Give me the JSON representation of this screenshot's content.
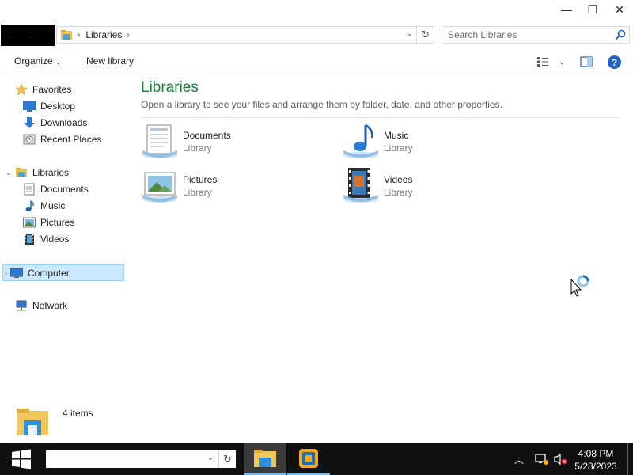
{
  "window": {
    "minimize_glyph": "—",
    "maximize_glyph": "❐",
    "close_glyph": "✕"
  },
  "address_bar": {
    "icon": "libraries-icon",
    "breadcrumb": "Libraries",
    "separator": "›"
  },
  "search": {
    "placeholder": "Search Libraries",
    "value": ""
  },
  "toolbar": {
    "organize_label": "Organize",
    "new_library_label": "New library"
  },
  "navigation": {
    "favorites": {
      "label": "Favorites",
      "items": [
        {
          "label": "Desktop",
          "icon": "desktop-icon"
        },
        {
          "label": "Downloads",
          "icon": "downloads-icon"
        },
        {
          "label": "Recent Places",
          "icon": "recent-places-icon"
        }
      ]
    },
    "libraries": {
      "label": "Libraries",
      "items": [
        {
          "label": "Documents",
          "icon": "documents-icon"
        },
        {
          "label": "Music",
          "icon": "music-icon"
        },
        {
          "label": "Pictures",
          "icon": "pictures-icon"
        },
        {
          "label": "Videos",
          "icon": "videos-icon"
        }
      ]
    },
    "computer": {
      "label": "Computer",
      "selected": true
    },
    "network": {
      "label": "Network"
    }
  },
  "content": {
    "title": "Libraries",
    "subtitle": "Open a library to see your files and arrange them by folder, date, and other properties.",
    "libraries": [
      {
        "name": "Documents",
        "type": "Library",
        "icon": "documents-library-icon"
      },
      {
        "name": "Music",
        "type": "Library",
        "icon": "music-library-icon"
      },
      {
        "name": "Pictures",
        "type": "Library",
        "icon": "pictures-library-icon"
      },
      {
        "name": "Videos",
        "type": "Library",
        "icon": "videos-library-icon"
      }
    ]
  },
  "details": {
    "item_count": "4 items"
  },
  "taskbar": {
    "search_value": "",
    "time": "4:08 PM",
    "date": "5/28/2023"
  },
  "colors": {
    "title_green": "#1e7d3a",
    "selection": "#cce8ff",
    "taskbar": "#101010",
    "accent": "#76b9ed"
  }
}
